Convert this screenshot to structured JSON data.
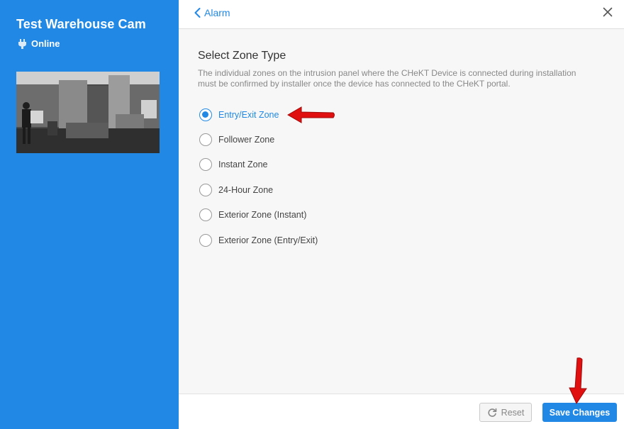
{
  "camera": {
    "name": "Test Warehouse Cam",
    "status": "Online",
    "status_icon": "plug-icon",
    "thumbnail_icon": "camera-feed-thumbnail",
    "thumbnail_caption": "Test Warehouse Cam"
  },
  "header": {
    "back_label": "Alarm",
    "back_icon": "chevron-left-icon",
    "close_icon": "close-icon"
  },
  "zone": {
    "title": "Select Zone Type",
    "description": "The individual zones on the intrusion panel where the CHeKT Device is connected during installation must be confirmed by installer once the device has connected to the CHeKT portal.",
    "selected": "Entry/Exit Zone",
    "options": [
      {
        "label": "Entry/Exit Zone",
        "checked": true
      },
      {
        "label": "Follower Zone",
        "checked": false
      },
      {
        "label": "Instant Zone",
        "checked": false
      },
      {
        "label": "24-Hour Zone",
        "checked": false
      },
      {
        "label": "Exterior Zone (Instant)",
        "checked": false
      },
      {
        "label": "Exterior Zone (Entry/Exit)",
        "checked": false
      }
    ]
  },
  "footer": {
    "reset_label": "Reset",
    "reset_icon": "refresh-icon",
    "save_label": "Save Changes"
  },
  "colors": {
    "accent": "#2189e5",
    "annotation_arrow": "#e01010"
  }
}
